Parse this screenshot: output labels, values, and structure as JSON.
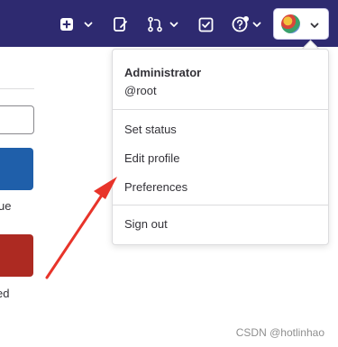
{
  "header": {
    "avatar_label": "User avatar menu"
  },
  "page": {
    "truncated_label_1": "ue",
    "truncated_label_2": "ed"
  },
  "user_menu": {
    "name": "Administrator",
    "username": "@root",
    "items": [
      "Set status",
      "Edit profile",
      "Preferences"
    ],
    "sign_out": "Sign out"
  },
  "watermark": "CSDN @hotlinhao",
  "colors": {
    "header_bg": "#2e2a70",
    "blue_card": "#1f5faa",
    "red_card": "#ad2a22",
    "annotation_arrow": "#e8342a"
  }
}
